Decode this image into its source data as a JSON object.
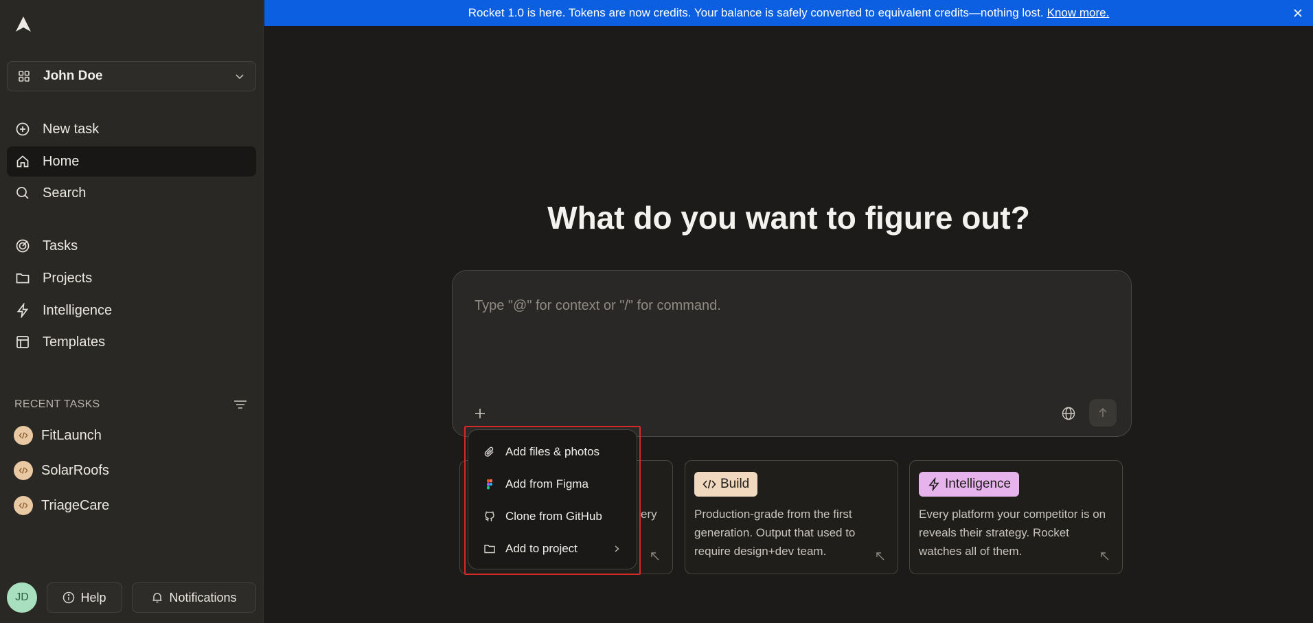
{
  "sidebar": {
    "workspace": "John Doe",
    "nav": [
      {
        "label": "New task",
        "icon": "plus-circle-icon"
      },
      {
        "label": "Home",
        "icon": "home-icon"
      },
      {
        "label": "Search",
        "icon": "search-icon"
      },
      {
        "label": "Tasks",
        "icon": "target-icon"
      },
      {
        "label": "Projects",
        "icon": "folder-icon"
      },
      {
        "label": "Intelligence",
        "icon": "lightning-icon"
      },
      {
        "label": "Templates",
        "icon": "layout-icon"
      }
    ],
    "recent_header": "RECENT TASKS",
    "recent": [
      {
        "label": "FitLaunch"
      },
      {
        "label": "SolarRoofs"
      },
      {
        "label": "TriageCare"
      }
    ],
    "avatar_initials": "JD",
    "help_label": "Help",
    "notifications_label": "Notifications"
  },
  "banner": {
    "text": "Rocket 1.0 is here. Tokens are now credits. Your balance is safely converted to equivalent credits—nothing lost.",
    "link": "Know more."
  },
  "main": {
    "headline": "What do you want to figure out?",
    "composer_placeholder": "Type \"@\" for context or \"/\" for command."
  },
  "cards": [
    {
      "tag": "",
      "desc": "ery",
      "tag_color": "#e8c9a3"
    },
    {
      "tag": "Build",
      "desc": "Production-grade from the first generation. Output that used to require design+dev team.",
      "tag_color": "#f0d9bf"
    },
    {
      "tag": "Intelligence",
      "desc": "Every platform your competitor is on reveals their strategy. Rocket watches all of them.",
      "tag_color": "#e6b3ec"
    }
  ],
  "popup": {
    "items": [
      {
        "label": "Add files & photos",
        "icon": "paperclip-icon"
      },
      {
        "label": "Add from Figma",
        "icon": "figma-icon"
      },
      {
        "label": "Clone from GitHub",
        "icon": "github-icon"
      },
      {
        "label": "Add to project",
        "icon": "folder-icon"
      }
    ]
  },
  "colors": {
    "banner": "#0b5fe0",
    "sidebar": "#2a2824",
    "background": "#1c1b19",
    "highlight": "#d42a2a"
  }
}
